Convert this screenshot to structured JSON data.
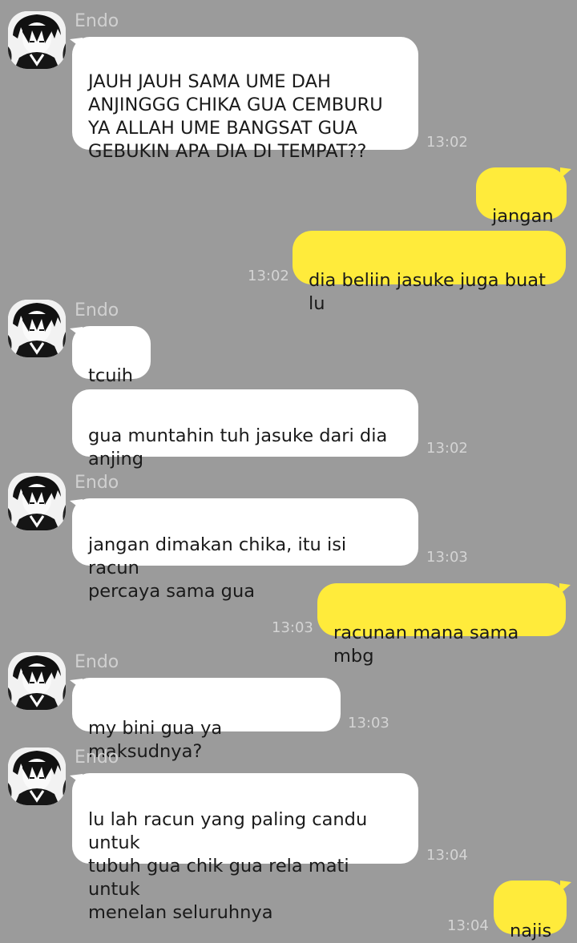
{
  "chat": {
    "messages": [
      {
        "from": "Endo",
        "dir": "in",
        "text": "JAUH JAUH SAMA UME DAH\nANJINGGG CHIKA GUA CEMBURU\nYA ALLAH UME BANGSAT GUA\nGEBUKIN APA DIA DI TEMPAT??",
        "time": "13:02"
      },
      {
        "dir": "out",
        "text": "jangan",
        "time": ""
      },
      {
        "dir": "out",
        "text": "dia beliin jasuke juga buat lu",
        "time": "13:02"
      },
      {
        "from": "Endo",
        "dir": "in",
        "text": "tcuih",
        "time": ""
      },
      {
        "dir": "in",
        "text": "gua muntahin tuh jasuke dari dia\nanjing",
        "time": "13:02"
      },
      {
        "from": "Endo",
        "dir": "in",
        "text": "jangan dimakan chika, itu isi racun\npercaya sama gua",
        "time": "13:03"
      },
      {
        "dir": "out",
        "text": "racunan mana sama mbg",
        "time": "13:03"
      },
      {
        "from": "Endo",
        "dir": "in",
        "text": "my bini gua ya maksudnya?",
        "time": "13:03"
      },
      {
        "from": "Endo",
        "dir": "in",
        "text": "lu lah racun yang paling candu untuk\ntubuh gua chik gua rela mati untuk\nmenelan seluruhnya",
        "time": "13:04"
      },
      {
        "dir": "out",
        "text": "najis",
        "time": "13:04"
      }
    ]
  },
  "colors": {
    "background": "#9b9b9b",
    "incoming_bubble": "#ffffff",
    "outgoing_bubble": "#ffeb3b",
    "sender_name": "#d0d0d0",
    "timestamp": "#d4d4d4"
  },
  "icons": {
    "avatar": "anime-character-avatar"
  }
}
